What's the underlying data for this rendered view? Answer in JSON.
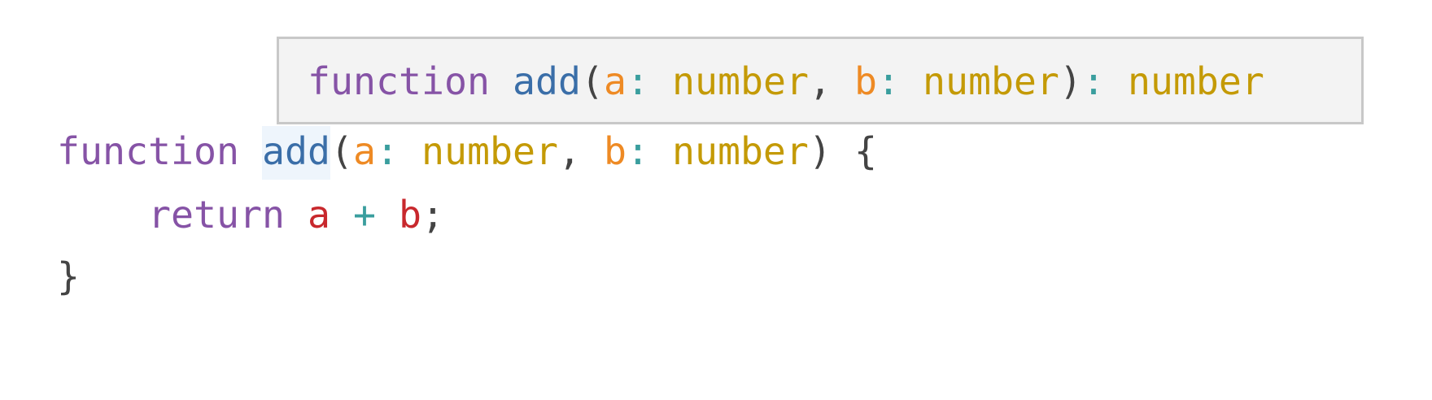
{
  "hover": {
    "kw": "function",
    "fn": "add",
    "open": "(",
    "p1": "a",
    "c1": ":",
    "t1": "number",
    "comma": ",",
    "p2": "b",
    "c2": ":",
    "t2": "number",
    "close": ")",
    "c3": ":",
    "ret": "number"
  },
  "code": {
    "line1": {
      "kw": "function",
      "fn": "add",
      "open": "(",
      "p1": "a",
      "c1": ":",
      "t1": "number",
      "comma": ",",
      "p2": "b",
      "c2": ":",
      "t2": "number",
      "close": ")",
      "brace": "{"
    },
    "line2": {
      "kw": "return",
      "v1": "a",
      "op": "+",
      "v2": "b",
      "semi": ";"
    },
    "line3": {
      "brace": "}"
    }
  },
  "colors": {
    "keyword": "#8653a6",
    "function": "#3a6ea8",
    "parameter": "#ee8a24",
    "type": "#c49a06",
    "operator": "#3a9e9e",
    "variable": "#c8282d",
    "punctuation": "#444444",
    "hover_background": "#f3f3f3",
    "hover_border": "#c8c8c8",
    "highlight": "#eef5fc"
  }
}
